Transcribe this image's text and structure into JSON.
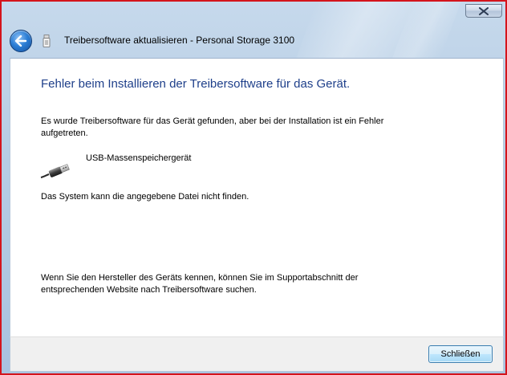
{
  "window": {
    "title": "Treibersoftware aktualisieren - Personal Storage 3100",
    "close_icon": "close-icon",
    "back_icon": "back-arrow-icon",
    "app_icon": "usb-drive-icon"
  },
  "content": {
    "heading": "Fehler beim Installieren der Treibersoftware für das Gerät.",
    "intro": "Es wurde Treibersoftware für das Gerät gefunden, aber bei der Installation ist ein Fehler aufgetreten.",
    "device": {
      "icon": "usb-plug-icon",
      "name": "USB-Massenspeichergerät"
    },
    "error_message": "Das System kann die angegebene Datei nicht finden.",
    "hint": "Wenn Sie den Hersteller des Geräts kennen, können Sie im Supportabschnitt der entsprechenden Website nach Treibersoftware suchen."
  },
  "footer": {
    "close_button_label": "Schließen"
  },
  "colors": {
    "heading": "#1e3f8a",
    "frame_border": "#d4141c",
    "button_border": "#3c7fb1"
  }
}
